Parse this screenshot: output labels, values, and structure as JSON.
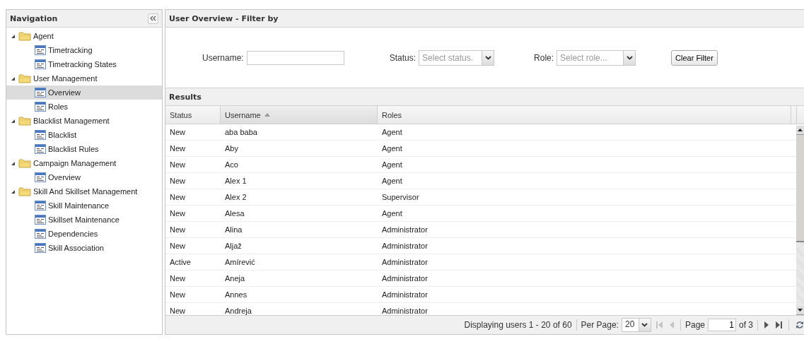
{
  "navigation": {
    "title": "Navigation",
    "items": [
      {
        "label": "Agent",
        "expanded": true,
        "children": [
          {
            "label": "Timetracking",
            "selected": false
          },
          {
            "label": "Timetracking States",
            "selected": false
          }
        ]
      },
      {
        "label": "User Management",
        "expanded": true,
        "children": [
          {
            "label": "Overview",
            "selected": true
          },
          {
            "label": "Roles",
            "selected": false
          }
        ]
      },
      {
        "label": "Blacklist Management",
        "expanded": true,
        "children": [
          {
            "label": "Blacklist",
            "selected": false
          },
          {
            "label": "Blacklist Rules",
            "selected": false
          }
        ]
      },
      {
        "label": "Campaign Management",
        "expanded": true,
        "children": [
          {
            "label": "Overview",
            "selected": false
          }
        ]
      },
      {
        "label": "Skill And Skillset Management",
        "expanded": true,
        "children": [
          {
            "label": "Skill Maintenance",
            "selected": false
          },
          {
            "label": "Skillset Maintenance",
            "selected": false
          },
          {
            "label": "Dependencies",
            "selected": false
          },
          {
            "label": "Skill Association",
            "selected": false
          }
        ]
      }
    ]
  },
  "filter": {
    "title": "User Overview - Filter by",
    "username_label": "Username:",
    "status_label": "Status:",
    "status_placeholder": "Select status.",
    "role_label": "Role:",
    "role_placeholder": "Select role...",
    "clear_button": "Clear Filter"
  },
  "results": {
    "title": "Results",
    "columns": [
      {
        "label": "Status",
        "sorted": false
      },
      {
        "label": "Username",
        "sorted": true
      },
      {
        "label": "Roles",
        "sorted": false
      }
    ],
    "rows": [
      [
        "New",
        "aba baba",
        "Agent"
      ],
      [
        "New",
        "Aby",
        "Agent"
      ],
      [
        "New",
        "Aco",
        "Agent"
      ],
      [
        "New",
        "Alex 1",
        "Agent"
      ],
      [
        "New",
        "Alex 2",
        "Supervisor"
      ],
      [
        "New",
        "Alesa",
        "Agent"
      ],
      [
        "New",
        "Alina",
        "Administrator"
      ],
      [
        "New",
        "Aljaž",
        "Administrator"
      ],
      [
        "Active",
        "Amírević",
        "Administrator"
      ],
      [
        "New",
        "Aneja",
        "Administrator"
      ],
      [
        "New",
        "Annes",
        "Administrator"
      ],
      [
        "New",
        "Andreja",
        "Administrator"
      ]
    ]
  },
  "pagination": {
    "display": "Displaying users 1 - 20 of 60",
    "per_page_label": "Per Page:",
    "per_page": "20",
    "first_disabled": true,
    "prev_disabled": true,
    "page_label": "Page",
    "page": "1",
    "of_pages": "of 3",
    "next_disabled": false,
    "last_disabled": false
  }
}
